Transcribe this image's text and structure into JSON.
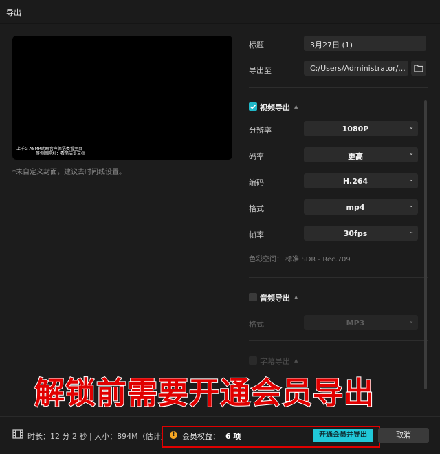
{
  "window": {
    "title": "导出"
  },
  "preview": {
    "caption_line1": "上千G ASMR助眠音声但语类看主页",
    "caption_line2": "等你回网址：看简洁处文档",
    "cover_hint": "*未自定义封面，建议去时间线设置。"
  },
  "basic": {
    "title_label": "标题",
    "title_value": "3月27日 (1)",
    "path_label": "导出至",
    "path_value": "C:/Users/Administrator/...",
    "folder_icon": "folder-icon"
  },
  "video": {
    "header": "视频导出",
    "checked": true,
    "settings": [
      {
        "label": "分辨率",
        "value": "1080P"
      },
      {
        "label": "码率",
        "value": "更高"
      },
      {
        "label": "编码",
        "value": "H.264"
      },
      {
        "label": "格式",
        "value": "mp4"
      },
      {
        "label": "帧率",
        "value": "30fps"
      }
    ],
    "colorspace": "色彩空间：  标准 SDR - Rec.709"
  },
  "audio": {
    "header": "音频导出",
    "checked": false,
    "format_label": "格式",
    "format_value": "MP3"
  },
  "subtitle": {
    "header": "字幕导出"
  },
  "banner": "解锁前需要开通会员导出",
  "footer": {
    "meta": "时长：12 分 2 秒 | 大小：894M（估计）",
    "benefit_label": "会员权益：",
    "benefit_value": "6 项",
    "vip_button": "开通会员并导出",
    "cancel_button": "取消"
  },
  "colors": {
    "accent": "#20c8d8",
    "warning": "#f5a623",
    "banner": "#e10000"
  }
}
